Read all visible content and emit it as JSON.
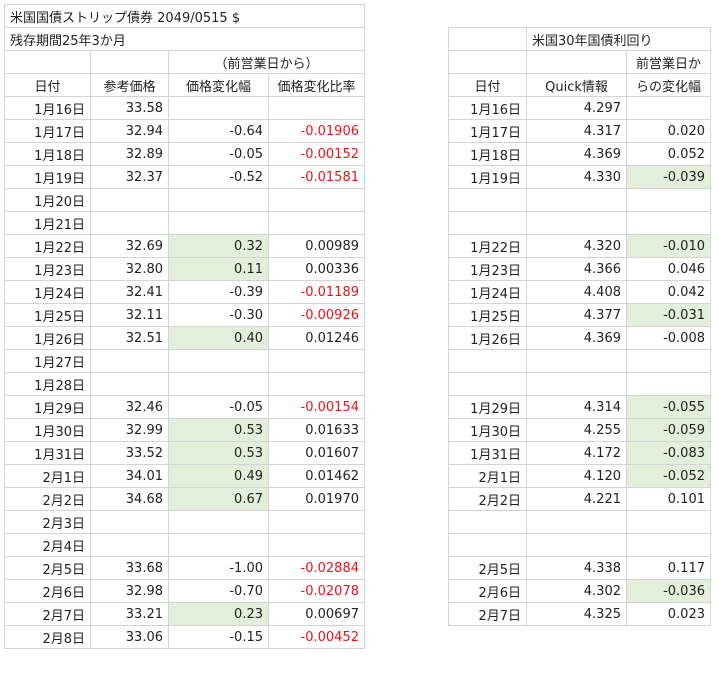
{
  "left": {
    "title": "米国国債ストリップ債券 2049/0515 $",
    "subtitle": "残存期間25年3か月",
    "group_header": "（前営業日から）",
    "headers": [
      "日付",
      "参考価格",
      "価格変化幅",
      "価格変化比率"
    ],
    "rows": [
      {
        "date": "1月16日",
        "price": "33.58",
        "change": "",
        "ratio": "",
        "hl": false,
        "neg": false
      },
      {
        "date": "1月17日",
        "price": "32.94",
        "change": "-0.64",
        "ratio": "-0.01906",
        "hl": false,
        "neg": true
      },
      {
        "date": "1月18日",
        "price": "32.89",
        "change": "-0.05",
        "ratio": "-0.00152",
        "hl": false,
        "neg": true
      },
      {
        "date": "1月19日",
        "price": "32.37",
        "change": "-0.52",
        "ratio": "-0.01581",
        "hl": false,
        "neg": true
      },
      {
        "date": "1月20日",
        "price": "",
        "change": "",
        "ratio": "",
        "hl": false,
        "neg": false
      },
      {
        "date": "1月21日",
        "price": "",
        "change": "",
        "ratio": "",
        "hl": false,
        "neg": false
      },
      {
        "date": "1月22日",
        "price": "32.69",
        "change": "0.32",
        "ratio": "0.00989",
        "hl": true,
        "neg": false
      },
      {
        "date": "1月23日",
        "price": "32.80",
        "change": "0.11",
        "ratio": "0.00336",
        "hl": true,
        "neg": false
      },
      {
        "date": "1月24日",
        "price": "32.41",
        "change": "-0.39",
        "ratio": "-0.01189",
        "hl": false,
        "neg": true
      },
      {
        "date": "1月25日",
        "price": "32.11",
        "change": "-0.30",
        "ratio": "-0.00926",
        "hl": false,
        "neg": true
      },
      {
        "date": "1月26日",
        "price": "32.51",
        "change": "0.40",
        "ratio": "0.01246",
        "hl": true,
        "neg": false
      },
      {
        "date": "1月27日",
        "price": "",
        "change": "",
        "ratio": "",
        "hl": false,
        "neg": false
      },
      {
        "date": "1月28日",
        "price": "",
        "change": "",
        "ratio": "",
        "hl": false,
        "neg": false
      },
      {
        "date": "1月29日",
        "price": "32.46",
        "change": "-0.05",
        "ratio": "-0.00154",
        "hl": false,
        "neg": true
      },
      {
        "date": "1月30日",
        "price": "32.99",
        "change": "0.53",
        "ratio": "0.01633",
        "hl": true,
        "neg": false
      },
      {
        "date": "1月31日",
        "price": "33.52",
        "change": "0.53",
        "ratio": "0.01607",
        "hl": true,
        "neg": false
      },
      {
        "date": "2月1日",
        "price": "34.01",
        "change": "0.49",
        "ratio": "0.01462",
        "hl": true,
        "neg": false
      },
      {
        "date": "2月2日",
        "price": "34.68",
        "change": "0.67",
        "ratio": "0.01970",
        "hl": true,
        "neg": false
      },
      {
        "date": "2月3日",
        "price": "",
        "change": "",
        "ratio": "",
        "hl": false,
        "neg": false
      },
      {
        "date": "2月4日",
        "price": "",
        "change": "",
        "ratio": "",
        "hl": false,
        "neg": false
      },
      {
        "date": "2月5日",
        "price": "33.68",
        "change": "-1.00",
        "ratio": "-0.02884",
        "hl": false,
        "neg": true
      },
      {
        "date": "2月6日",
        "price": "32.98",
        "change": "-0.70",
        "ratio": "-0.02078",
        "hl": false,
        "neg": true
      },
      {
        "date": "2月7日",
        "price": "33.21",
        "change": "0.23",
        "ratio": "0.00697",
        "hl": true,
        "neg": false
      },
      {
        "date": "2月8日",
        "price": "33.06",
        "change": "-0.15",
        "ratio": "-0.00452",
        "hl": false,
        "neg": true
      }
    ]
  },
  "right": {
    "title": "米国30年国債利回り",
    "change_header_1": "前営業日か",
    "change_header_2": "らの変化幅",
    "headers": [
      "日付",
      "Quick情報"
    ],
    "rows": [
      {
        "date": "1月16日",
        "yield": "4.297",
        "change": "",
        "hl": false
      },
      {
        "date": "1月17日",
        "yield": "4.317",
        "change": "0.020",
        "hl": false
      },
      {
        "date": "1月18日",
        "yield": "4.369",
        "change": "0.052",
        "hl": false
      },
      {
        "date": "1月19日",
        "yield": "4.330",
        "change": "-0.039",
        "hl": true
      },
      {
        "date": "",
        "yield": "",
        "change": "",
        "hl": false
      },
      {
        "date": "",
        "yield": "",
        "change": "",
        "hl": false
      },
      {
        "date": "1月22日",
        "yield": "4.320",
        "change": "-0.010",
        "hl": true
      },
      {
        "date": "1月23日",
        "yield": "4.366",
        "change": "0.046",
        "hl": false
      },
      {
        "date": "1月24日",
        "yield": "4.408",
        "change": "0.042",
        "hl": false
      },
      {
        "date": "1月25日",
        "yield": "4.377",
        "change": "-0.031",
        "hl": true
      },
      {
        "date": "1月26日",
        "yield": "4.369",
        "change": "-0.008",
        "hl": false
      },
      {
        "date": "",
        "yield": "",
        "change": "",
        "hl": false
      },
      {
        "date": "",
        "yield": "",
        "change": "",
        "hl": false
      },
      {
        "date": "1月29日",
        "yield": "4.314",
        "change": "-0.055",
        "hl": true
      },
      {
        "date": "1月30日",
        "yield": "4.255",
        "change": "-0.059",
        "hl": true
      },
      {
        "date": "1月31日",
        "yield": "4.172",
        "change": "-0.083",
        "hl": true
      },
      {
        "date": "2月1日",
        "yield": "4.120",
        "change": "-0.052",
        "hl": true
      },
      {
        "date": "2月2日",
        "yield": "4.221",
        "change": "0.101",
        "hl": false
      },
      {
        "date": "",
        "yield": "",
        "change": "",
        "hl": false
      },
      {
        "date": "",
        "yield": "",
        "change": "",
        "hl": false
      },
      {
        "date": "2月5日",
        "yield": "4.338",
        "change": "0.117",
        "hl": false
      },
      {
        "date": "2月6日",
        "yield": "4.302",
        "change": "-0.036",
        "hl": true
      },
      {
        "date": "2月7日",
        "yield": "4.325",
        "change": "0.023",
        "hl": false
      }
    ]
  }
}
